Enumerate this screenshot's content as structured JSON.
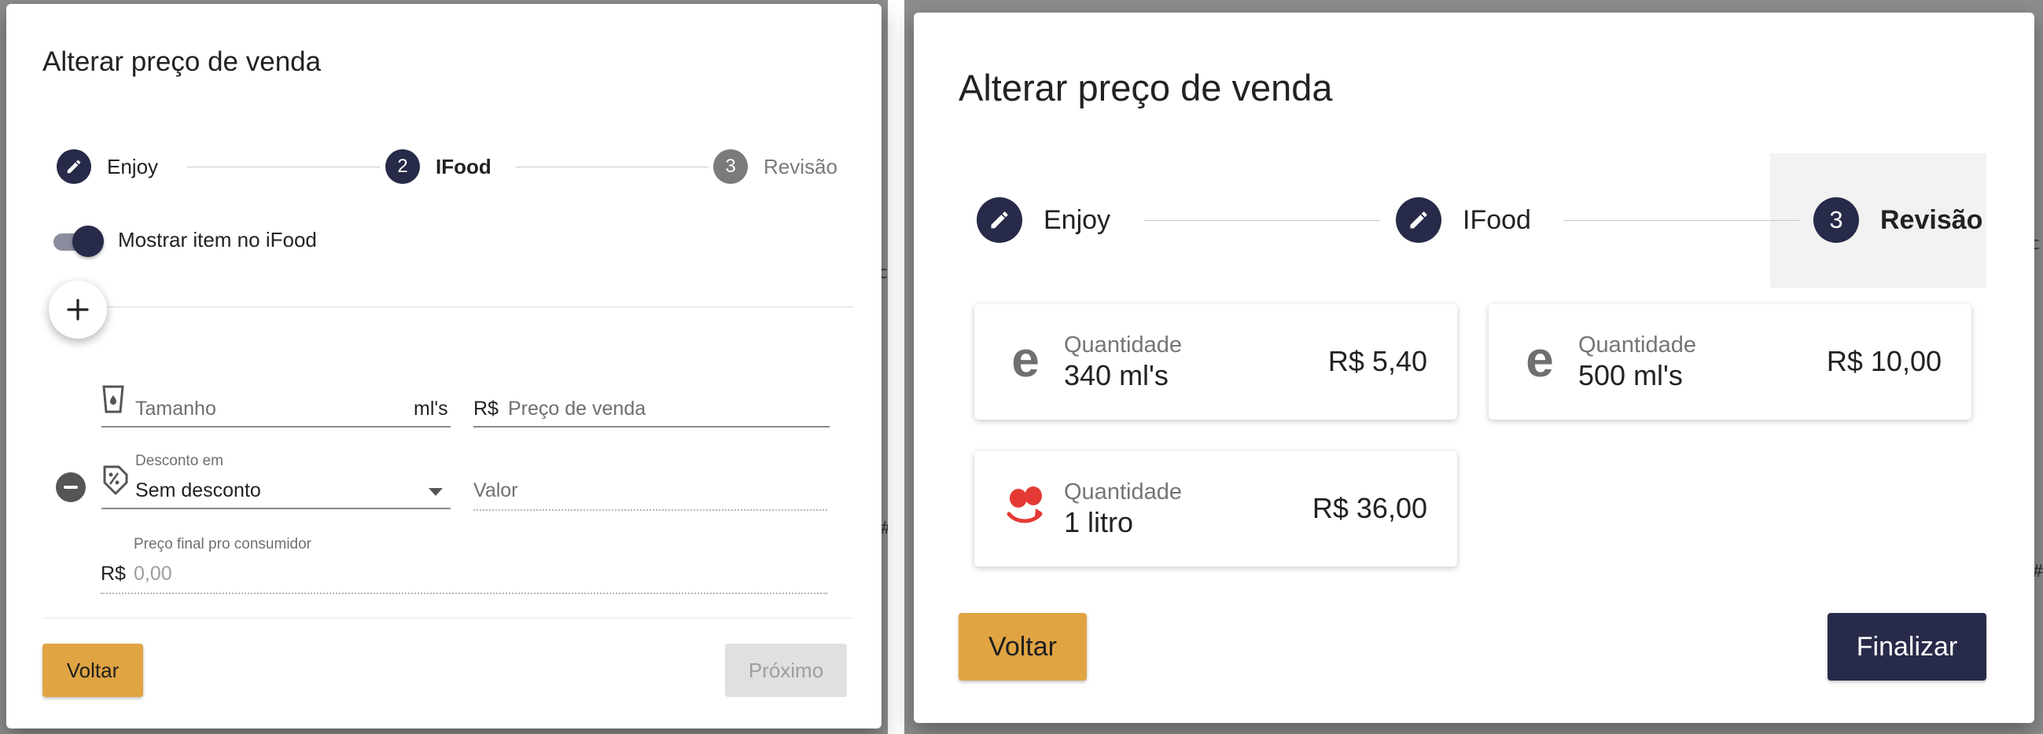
{
  "left_dialog": {
    "title": "Alterar preço de venda",
    "steps": [
      {
        "label": "Enjoy",
        "number": "",
        "icon": "pencil-icon",
        "state": "edited"
      },
      {
        "label": "IFood",
        "number": "2",
        "state": "active"
      },
      {
        "label": "Revisão",
        "number": "3",
        "state": "inactive"
      }
    ],
    "toggle": {
      "label": "Mostrar item no iFood",
      "on": true
    },
    "add_button": {
      "icon": "plus-icon"
    },
    "form": {
      "size_placeholder": "Tamanho",
      "size_unit": "ml's",
      "price_prefix": "R$",
      "price_placeholder": "Preço de venda",
      "discount_label": "Desconto em",
      "discount_value": "Sem desconto",
      "value_placeholder": "Valor",
      "final_price_label": "Preço final pro consumidor",
      "final_price_prefix": "R$",
      "final_price_value": "0,00"
    },
    "buttons": {
      "back": "Voltar",
      "next": "Próximo"
    }
  },
  "right_dialog": {
    "title": "Alterar preço de venda",
    "steps": [
      {
        "label": "Enjoy",
        "number": "",
        "icon": "pencil-icon",
        "state": "edited"
      },
      {
        "label": "IFood",
        "number": "",
        "icon": "pencil-icon",
        "state": "edited"
      },
      {
        "label": "Revisão",
        "number": "3",
        "state": "active"
      }
    ],
    "cards": [
      {
        "platform": "enjoy",
        "icon": "enjoy-logo-icon",
        "quantity_label": "Quantidade",
        "quantity": "340 ml's",
        "price": "R$ 5,40"
      },
      {
        "platform": "enjoy",
        "icon": "enjoy-logo-icon",
        "quantity_label": "Quantidade",
        "quantity": "500 ml's",
        "price": "R$ 10,00"
      },
      {
        "platform": "ifood",
        "icon": "ifood-logo-icon",
        "quantity_label": "Quantidade",
        "quantity": "1 litro",
        "price": "R$ 36,00"
      }
    ],
    "buttons": {
      "back": "Voltar",
      "finish": "Finalizar"
    }
  },
  "colors": {
    "primary": "#272a48",
    "accent": "#e0a443",
    "inactive_step": "#7b7b7b",
    "backdrop": "#8d8d8d",
    "ifood_red": "#e53935",
    "disabled_button": "#e0e0e0"
  }
}
